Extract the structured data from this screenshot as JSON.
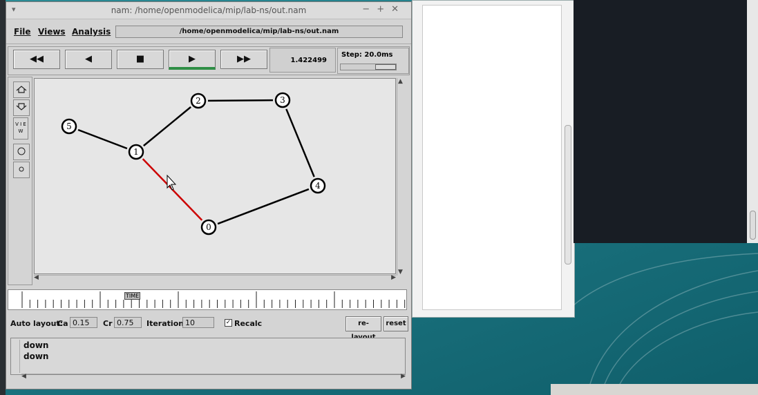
{
  "window": {
    "title": "nam: /home/openmodelica/mip/lab-ns/out.nam",
    "buttons": [
      "−",
      "+",
      "✕"
    ]
  },
  "menu": {
    "file": "File",
    "views": "Views",
    "analysis": "Analysis",
    "path": "/home/openmodelica/mip/lab-ns/out.nam"
  },
  "controls": {
    "rewind_glyph": "◀◀",
    "back_glyph": "◀",
    "stop_glyph": "■",
    "play_glyph": "▶",
    "ffwd_glyph": "▶▶",
    "active": "play",
    "time": "1.422499",
    "step": "Step: 20.0ms"
  },
  "tools": {
    "view_label": "V I E W"
  },
  "topology": {
    "nodes": [
      "0",
      "1",
      "2",
      "3",
      "4",
      "5"
    ],
    "links": [
      {
        "from": "5",
        "to": "1",
        "color": "#000000"
      },
      {
        "from": "1",
        "to": "2",
        "color": "#000000"
      },
      {
        "from": "2",
        "to": "3",
        "color": "#000000"
      },
      {
        "from": "3",
        "to": "4",
        "color": "#000000"
      },
      {
        "from": "4",
        "to": "0",
        "color": "#000000"
      },
      {
        "from": "1",
        "to": "0",
        "color": "#cc0000"
      }
    ]
  },
  "timeline": {
    "label": "TIME"
  },
  "layout": {
    "auto_layout": "Auto layout:",
    "ca_label": "Ca",
    "ca_value": "0.15",
    "cr_label": "Cr",
    "cr_value": "0.75",
    "iterations_label": "Iterations",
    "iterations_value": "10",
    "recalc_label": "Recalc",
    "recalc_checked": true,
    "relayout": "re-layout",
    "reset": "reset"
  },
  "log": {
    "lines": [
      "down",
      "down"
    ]
  }
}
